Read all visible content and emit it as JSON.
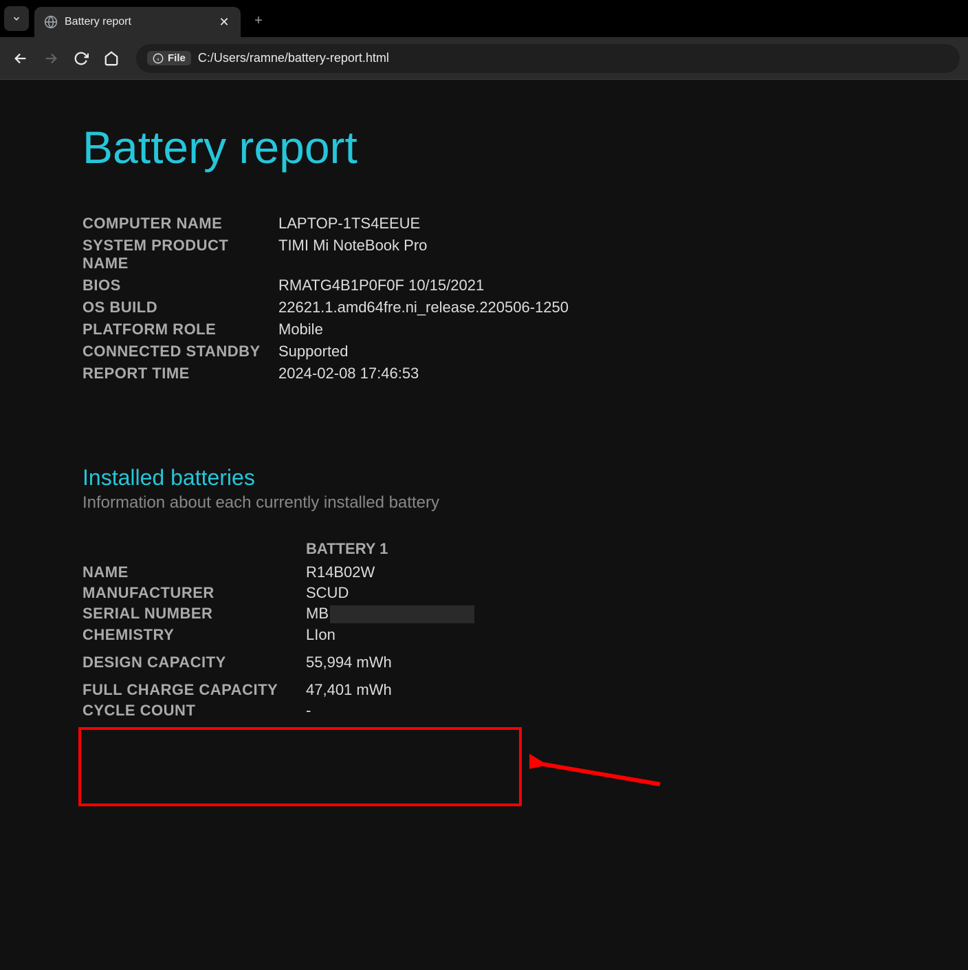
{
  "browser": {
    "tab_title": "Battery report",
    "url": "C:/Users/ramne/battery-report.html",
    "file_chip": "File"
  },
  "report": {
    "title": "Battery report",
    "system_info": [
      {
        "label": "COMPUTER NAME",
        "value": "LAPTOP-1TS4EEUE"
      },
      {
        "label": "SYSTEM PRODUCT NAME",
        "value": "TIMI Mi NoteBook Pro"
      },
      {
        "label": "BIOS",
        "value": "RMATG4B1P0F0F 10/15/2021"
      },
      {
        "label": "OS BUILD",
        "value": "22621.1.amd64fre.ni_release.220506-1250"
      },
      {
        "label": "PLATFORM ROLE",
        "value": "Mobile"
      },
      {
        "label": "CONNECTED STANDBY",
        "value": "Supported"
      },
      {
        "label": "REPORT TIME",
        "value": "2024-02-08  17:46:53"
      }
    ],
    "installed_section": {
      "title": "Installed batteries",
      "description": "Information about each currently installed battery",
      "battery_header": "BATTERY 1",
      "rows": [
        {
          "label": "NAME",
          "value": "R14B02W"
        },
        {
          "label": "MANUFACTURER",
          "value": "SCUD"
        },
        {
          "label": "SERIAL NUMBER",
          "value": "MB",
          "redacted": true
        },
        {
          "label": "CHEMISTRY",
          "value": "LIon"
        },
        {
          "label": "DESIGN CAPACITY",
          "value": "55,994 mWh",
          "highlighted": true
        },
        {
          "label": "FULL CHARGE CAPACITY",
          "value": "47,401 mWh",
          "highlighted": true
        },
        {
          "label": "CYCLE COUNT",
          "value": "-"
        }
      ]
    }
  }
}
